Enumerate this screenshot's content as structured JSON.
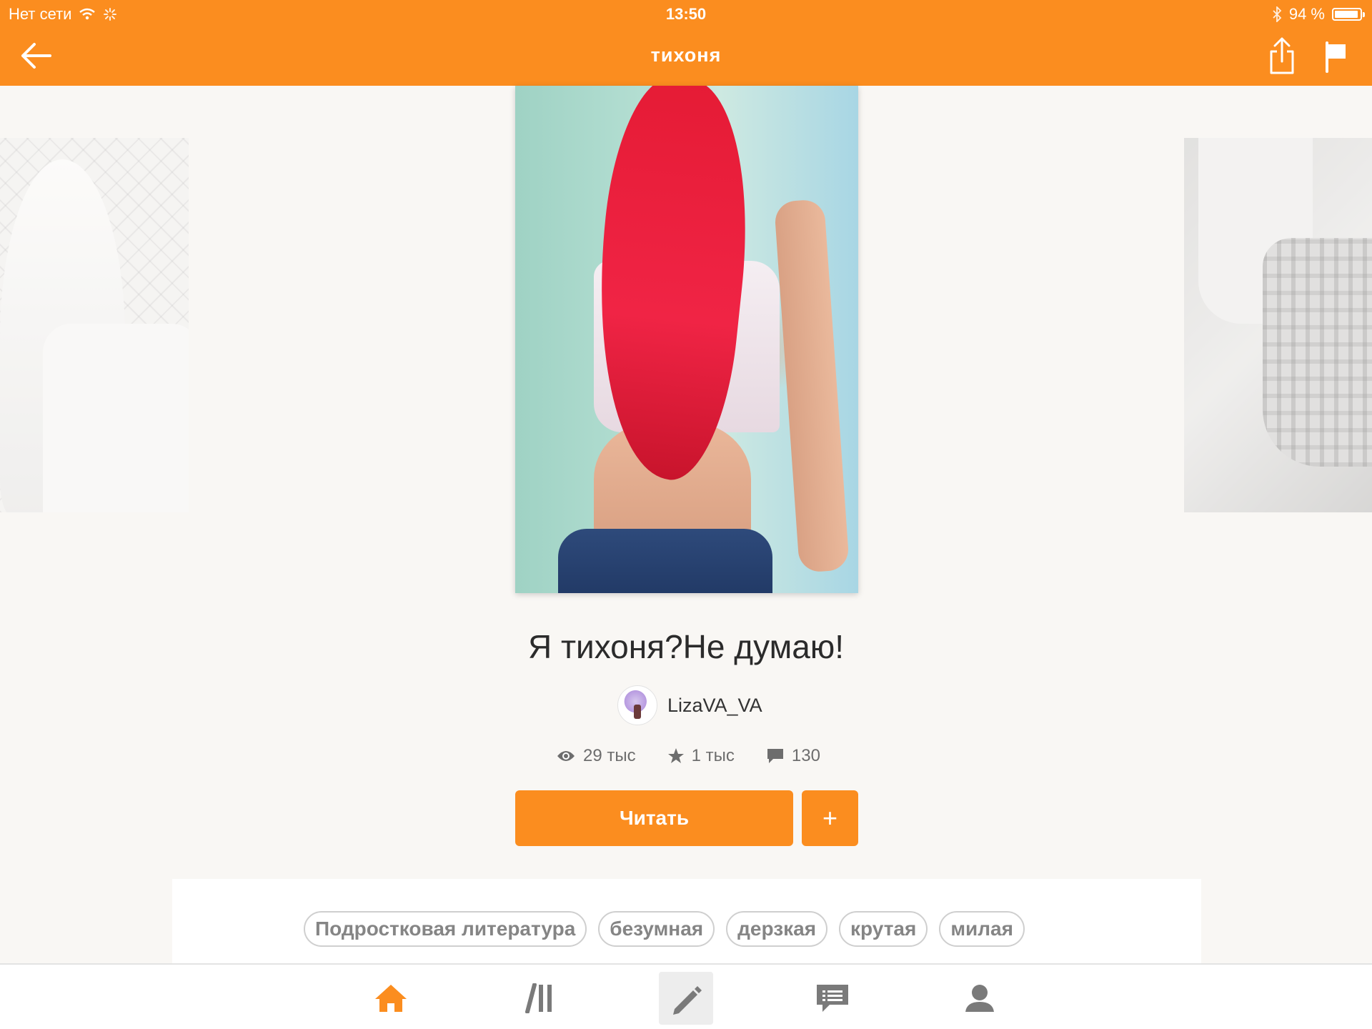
{
  "status_bar": {
    "carrier": "Нет сети",
    "time": "13:50",
    "battery_text": "94 %",
    "battery_level": 0.94
  },
  "nav": {
    "title": "тихоня",
    "back_icon": "back-arrow-icon",
    "share_icon": "share-icon",
    "flag_icon": "flag-icon"
  },
  "story": {
    "title": "Я тихоня?Не думаю!",
    "author": "LizaVA_VA",
    "stats": {
      "views": "29 тыс",
      "votes": "1 тыс",
      "comments": "130"
    },
    "read_label": "Читать",
    "add_label": "+"
  },
  "tags": [
    "Подростковая литература",
    "безумная",
    "дерзкая",
    "крутая",
    "милая"
  ],
  "tabbar": {
    "items": [
      {
        "name": "home",
        "icon": "home-icon",
        "active": true
      },
      {
        "name": "library",
        "icon": "library-icon",
        "active": false
      },
      {
        "name": "write",
        "icon": "pencil-icon",
        "active": false
      },
      {
        "name": "messages",
        "icon": "messages-icon",
        "active": false
      },
      {
        "name": "profile",
        "icon": "profile-icon",
        "active": false
      }
    ]
  },
  "colors": {
    "accent": "#fb8d1f",
    "background": "#f9f7f4"
  }
}
